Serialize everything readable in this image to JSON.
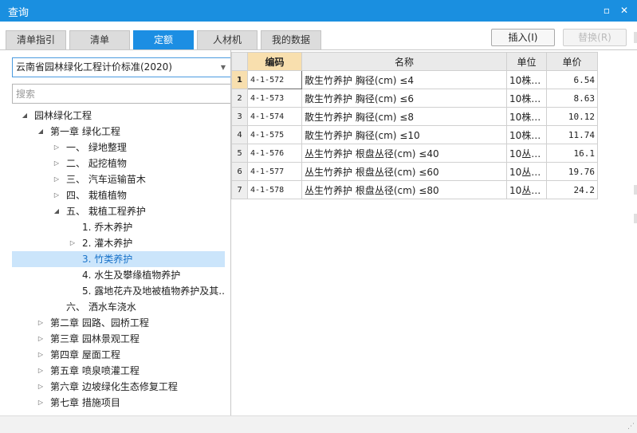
{
  "window": {
    "title": "查询",
    "minimize_glyph": "▫",
    "close_glyph": "✕"
  },
  "tabs": [
    {
      "label": "清单指引",
      "active": false
    },
    {
      "label": "清单",
      "active": false
    },
    {
      "label": "定额",
      "active": true
    },
    {
      "label": "人材机",
      "active": false
    },
    {
      "label": "我的数据",
      "active": false
    }
  ],
  "actions": {
    "insert_label": "插入(I)",
    "replace_label": "替换(R)"
  },
  "left_panel": {
    "standard_select": "云南省园林绿化工程计价标准(2020)",
    "search_placeholder": "搜索",
    "tree": [
      {
        "label": "园林绿化工程",
        "toggle": "◢",
        "depth": 0
      },
      {
        "label": "第一章 绿化工程",
        "toggle": "◢",
        "depth": 1
      },
      {
        "label": "一、  绿地整理",
        "toggle": "▷",
        "depth": 2
      },
      {
        "label": "二、  起挖植物",
        "toggle": "▷",
        "depth": 2
      },
      {
        "label": "三、  汽车运输苗木",
        "toggle": "▷",
        "depth": 2
      },
      {
        "label": "四、  栽植植物",
        "toggle": "▷",
        "depth": 2
      },
      {
        "label": "五、  栽植工程养护",
        "toggle": "◢",
        "depth": 2
      },
      {
        "label": "1. 乔木养护",
        "toggle": "",
        "depth": 3
      },
      {
        "label": "2. 灌木养护",
        "toggle": "▷",
        "depth": 3
      },
      {
        "label": "3. 竹类养护",
        "toggle": "",
        "depth": 3,
        "selected": true
      },
      {
        "label": "4. 水生及攀缘植物养护",
        "toggle": "",
        "depth": 3
      },
      {
        "label": "5. 露地花卉及地被植物养护及其...",
        "toggle": "",
        "depth": 3
      },
      {
        "label": "六、  洒水车浇水",
        "toggle": "",
        "depth": 2
      },
      {
        "label": "第二章 园路、园桥工程",
        "toggle": "▷",
        "depth": 1
      },
      {
        "label": "第三章 园林景观工程",
        "toggle": "▷",
        "depth": 1
      },
      {
        "label": "第四章 屋面工程",
        "toggle": "▷",
        "depth": 1
      },
      {
        "label": "第五章 喷泉喷灌工程",
        "toggle": "▷",
        "depth": 1
      },
      {
        "label": "第六章 边坡绿化生态修复工程",
        "toggle": "▷",
        "depth": 1
      },
      {
        "label": "第七章 措施项目",
        "toggle": "▷",
        "depth": 1
      }
    ]
  },
  "grid": {
    "headers": {
      "code": "编码",
      "name": "名称",
      "unit": "单位",
      "price": "单价"
    },
    "rows": [
      {
        "num": "1",
        "code": "4-1-572",
        "name": "散生竹养护 胸径(cm) ≤4",
        "unit": "10株…",
        "price": "6.54"
      },
      {
        "num": "2",
        "code": "4-1-573",
        "name": "散生竹养护 胸径(cm) ≤6",
        "unit": "10株…",
        "price": "8.63"
      },
      {
        "num": "3",
        "code": "4-1-574",
        "name": "散生竹养护 胸径(cm) ≤8",
        "unit": "10株…",
        "price": "10.12"
      },
      {
        "num": "4",
        "code": "4-1-575",
        "name": "散生竹养护 胸径(cm) ≤10",
        "unit": "10株…",
        "price": "11.74"
      },
      {
        "num": "5",
        "code": "4-1-576",
        "name": "丛生竹养护 根盘丛径(cm) ≤40",
        "unit": "10丛…",
        "price": "16.1"
      },
      {
        "num": "6",
        "code": "4-1-577",
        "name": "丛生竹养护 根盘丛径(cm) ≤60",
        "unit": "10丛…",
        "price": "19.76"
      },
      {
        "num": "7",
        "code": "4-1-578",
        "name": "丛生竹养护 根盘丛径(cm) ≤80",
        "unit": "10丛…",
        "price": "24.2"
      }
    ]
  }
}
